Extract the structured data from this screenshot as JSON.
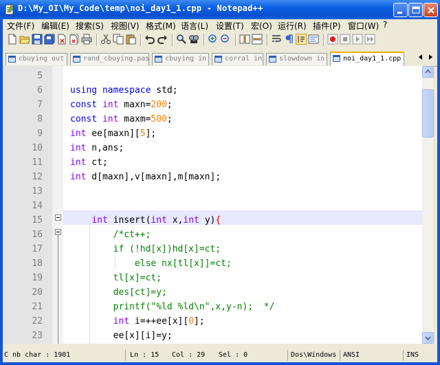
{
  "window": {
    "title": "D:\\My_OI\\My_Code\\temp\\noi_day1_1.cpp - Notepad++",
    "buttons": {
      "minimize": "minimize-icon",
      "maximize": "maximize-icon",
      "close": "close-icon"
    }
  },
  "menu": [
    "文件(F)",
    "编辑(E)",
    "搜索(S)",
    "视图(V)",
    "格式(M)",
    "语言(L)",
    "设置(T)",
    "宏(O)",
    "运行(R)",
    "插件(P)",
    "窗口(W)",
    "?"
  ],
  "tabs": [
    {
      "label": "cbuying out",
      "active": false
    },
    {
      "label": "rand_cbuying.pas",
      "active": false
    },
    {
      "label": "cbuying in",
      "active": false
    },
    {
      "label": "corral in",
      "active": false
    },
    {
      "label": "slowdown in",
      "active": false
    },
    {
      "label": "noi_day1_1.cpp",
      "active": true
    }
  ],
  "editor": {
    "lines": [
      {
        "n": "5",
        "text": ""
      },
      {
        "n": "6",
        "text": "using namespace std;"
      },
      {
        "n": "7",
        "text": "const int maxn=200;"
      },
      {
        "n": "8",
        "text": "const int maxm=500;"
      },
      {
        "n": "9",
        "text": "int ee[maxn][5];"
      },
      {
        "n": "10",
        "text": "int n,ans;"
      },
      {
        "n": "11",
        "text": "int ct;"
      },
      {
        "n": "12",
        "text": "int d[maxn],v[maxn],m[maxn];"
      },
      {
        "n": "13",
        "text": ""
      },
      {
        "n": "14",
        "text": ""
      },
      {
        "n": "15",
        "text": "    int insert(int x,int y){"
      },
      {
        "n": "16",
        "text": "        /*ct++;"
      },
      {
        "n": "17",
        "text": "        if (!hd[x])hd[x]=ct;"
      },
      {
        "n": "18",
        "text": "            else nx[tl[x]]=ct;"
      },
      {
        "n": "19",
        "text": "        tl[x]=ct;"
      },
      {
        "n": "20",
        "text": "        des[ct]=y;"
      },
      {
        "n": "21",
        "text": "        printf(\"%ld %ld\\n\",x,y-n);  */"
      },
      {
        "n": "22",
        "text": "        int i=++ee[x][0];"
      },
      {
        "n": "23",
        "text": "        ee[x][i]=y;"
      }
    ]
  },
  "status": {
    "length": "C nb char : 1901",
    "line": "Ln : 15",
    "col": "Col : 29",
    "sel": "Sel : 0",
    "eol": "Dos\\Windows",
    "encoding": "ANSI",
    "mode": "INS"
  },
  "colors": {
    "keyword": "#0000ff",
    "type": "#8000ff",
    "number": "#ff8000",
    "comment": "#008000",
    "current_line": "#e8e8ff"
  }
}
